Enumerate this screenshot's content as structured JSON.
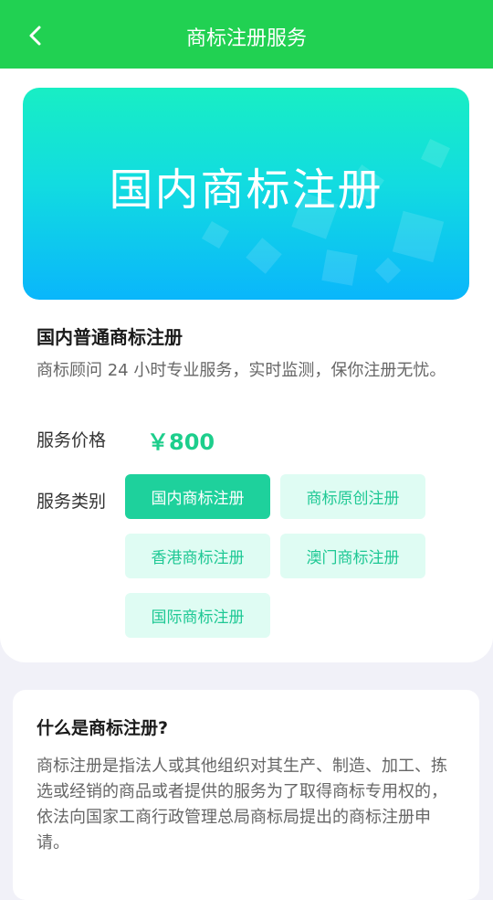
{
  "header": {
    "title": "商标注册服务",
    "back_icon": "chevron-left-icon",
    "color": "#21d152"
  },
  "banner": {
    "title": "国内商标注册"
  },
  "product": {
    "title": "国内普通商标注册",
    "description": "商标顾问 24 小时专业服务，实时监测，保你注册无忧。",
    "price_label": "服务价格",
    "price": "￥800",
    "category_label": "服务类别",
    "categories": [
      {
        "label": "国内商标注册",
        "selected": true
      },
      {
        "label": "商标原创注册",
        "selected": false
      },
      {
        "label": "香港商标注册",
        "selected": false
      },
      {
        "label": "澳门商标注册",
        "selected": false
      },
      {
        "label": "国际商标注册",
        "selected": false
      }
    ]
  },
  "info": {
    "title": "什么是商标注册?",
    "body": "商标注册是指法人或其他组织对其生产、制造、加工、拣选或经销的商品或者提供的服务为了取得商标专用权的，依法向国家工商行政管理总局商标局提出的商标注册申请。"
  },
  "colors": {
    "accent": "#1ed19c",
    "chip_bg": "#dffcf3"
  }
}
